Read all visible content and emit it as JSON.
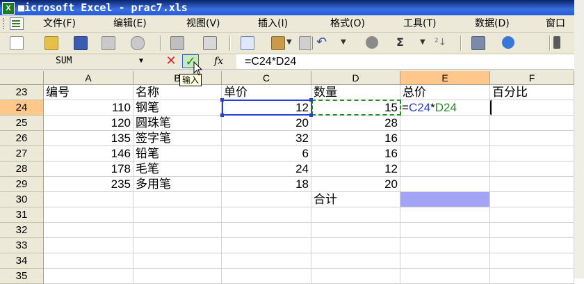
{
  "window": {
    "title": "Microsoft Excel - prac7.xls",
    "title_display": "■icrosoft Excel - prac7.xls"
  },
  "menubar": {
    "items": [
      {
        "label": "文件(F)"
      },
      {
        "label": "编辑(E)"
      },
      {
        "label": "视图(V)"
      },
      {
        "label": "插入(I)"
      },
      {
        "label": "格式(O)"
      },
      {
        "label": "工具(T)"
      },
      {
        "label": "数据(D)"
      },
      {
        "label": "窗口"
      }
    ]
  },
  "toolbar": {
    "sigma": "Σ",
    "sort": "A↓",
    "sort_label": "²↓"
  },
  "formula_bar": {
    "name_box": "SUM",
    "fx_label": "fx",
    "formula": "=C24*D24",
    "tooltip": "输入"
  },
  "columns": [
    "A",
    "B",
    "C",
    "D",
    "E",
    "F"
  ],
  "rows": [
    {
      "num": "23",
      "a": "编号",
      "b": "名称",
      "c": "单价",
      "d": "数量",
      "e": "总价",
      "f": "百分比"
    },
    {
      "num": "24",
      "a": "110",
      "b": "钢笔",
      "c": "12",
      "d": "15",
      "e_ref1": "C24",
      "e_op": "*",
      "e_ref2": "D24",
      "e_eq": "=",
      "f": ""
    },
    {
      "num": "25",
      "a": "120",
      "b": "圆珠笔",
      "c": "20",
      "d": "28",
      "e": "",
      "f": ""
    },
    {
      "num": "26",
      "a": "135",
      "b": "签字笔",
      "c": "32",
      "d": "16",
      "e": "",
      "f": ""
    },
    {
      "num": "27",
      "a": "146",
      "b": "铅笔",
      "c": "6",
      "d": "16",
      "e": "",
      "f": ""
    },
    {
      "num": "28",
      "a": "178",
      "b": "毛笔",
      "c": "24",
      "d": "12",
      "e": "",
      "f": ""
    },
    {
      "num": "29",
      "a": "235",
      "b": "多用笔",
      "c": "18",
      "d": "20",
      "e": "",
      "f": ""
    },
    {
      "num": "30",
      "a": "",
      "b": "",
      "c": "",
      "d": "合计",
      "e": "",
      "f": ""
    },
    {
      "num": "31",
      "a": "",
      "b": "",
      "c": "",
      "d": "",
      "e": "",
      "f": ""
    },
    {
      "num": "32",
      "a": "",
      "b": "",
      "c": "",
      "d": "",
      "e": "",
      "f": ""
    },
    {
      "num": "33",
      "a": "",
      "b": "",
      "c": "",
      "d": "",
      "e": "",
      "f": ""
    },
    {
      "num": "34",
      "a": "",
      "b": "",
      "c": "",
      "d": "",
      "e": "",
      "f": ""
    },
    {
      "num": "35",
      "a": "",
      "b": "",
      "c": "",
      "d": "",
      "e": "",
      "f": ""
    }
  ],
  "colors": {
    "selection": "#2a3fd6",
    "reference2": "#2a8a2a",
    "highlight_e30": "#a4a4f4",
    "active_header": "#ffc88a"
  }
}
